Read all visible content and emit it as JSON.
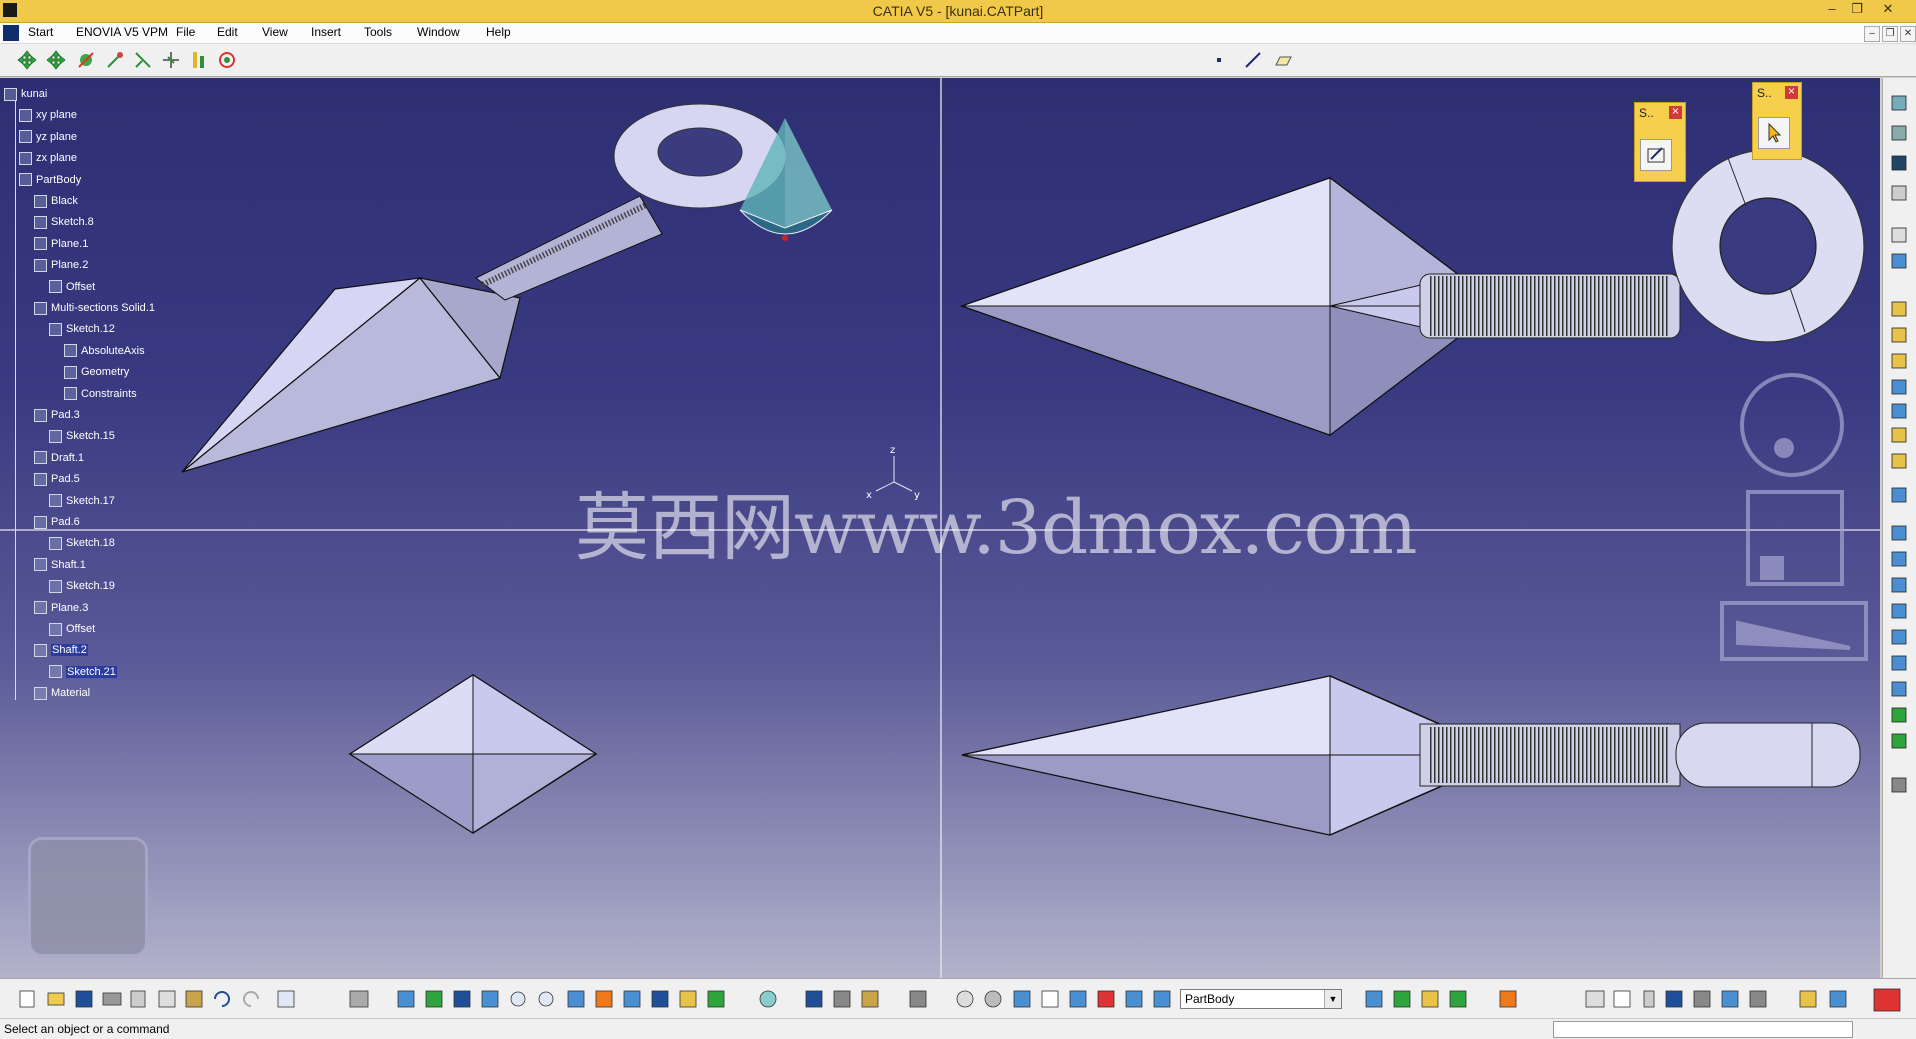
{
  "window": {
    "title": "CATIA V5 - [kunai.CATPart]",
    "minimize": "‒",
    "restore": "❐",
    "close": "✕"
  },
  "menu": [
    "Start",
    "ENOVIA V5 VPM",
    "File",
    "Edit",
    "View",
    "Insert",
    "Tools",
    "Window",
    "Help"
  ],
  "tree": [
    {
      "label": "kunai",
      "level": 0
    },
    {
      "label": "xy plane",
      "level": 1
    },
    {
      "label": "yz plane",
      "level": 1
    },
    {
      "label": "zx plane",
      "level": 1
    },
    {
      "label": "PartBody",
      "level": 1
    },
    {
      "label": "Black",
      "level": 2
    },
    {
      "label": "Sketch.8",
      "level": 2
    },
    {
      "label": "Plane.1",
      "level": 2
    },
    {
      "label": "Plane.2",
      "level": 2
    },
    {
      "label": "Offset",
      "level": 3
    },
    {
      "label": "Multi-sections Solid.1",
      "level": 2
    },
    {
      "label": "Sketch.12",
      "level": 3
    },
    {
      "label": "AbsoluteAxis",
      "level": 4
    },
    {
      "label": "Geometry",
      "level": 4
    },
    {
      "label": "Constraints",
      "level": 4
    },
    {
      "label": "Pad.3",
      "level": 2
    },
    {
      "label": "Sketch.15",
      "level": 3
    },
    {
      "label": "Draft.1",
      "level": 2
    },
    {
      "label": "Pad.5",
      "level": 2
    },
    {
      "label": "Sketch.17",
      "level": 3
    },
    {
      "label": "Pad.6",
      "level": 2
    },
    {
      "label": "Sketch.18",
      "level": 3
    },
    {
      "label": "Shaft.1",
      "level": 2
    },
    {
      "label": "Sketch.19",
      "level": 3
    },
    {
      "label": "Plane.3",
      "level": 2
    },
    {
      "label": "Offset",
      "level": 3
    },
    {
      "label": "Shaft.2",
      "level": 2
    },
    {
      "label": "Sketch.21",
      "level": 3
    },
    {
      "label": "Material",
      "level": 2
    }
  ],
  "watermark": "莫西网www.3dmox.com",
  "axis_labels": {
    "z": "z",
    "x": "x",
    "y": "y"
  },
  "select_panels": [
    {
      "title": "S..",
      "close": "×"
    },
    {
      "title": "S..",
      "close": "×"
    }
  ],
  "current_body": "PartBody",
  "combo_arrow": "▼",
  "status": "Select an object or a command",
  "colors": {
    "title_bar": "#f1c94a",
    "viewport_top": "#2e2e73",
    "viewport_bottom": "#b3b3cc",
    "part": "#c9c9ee"
  }
}
